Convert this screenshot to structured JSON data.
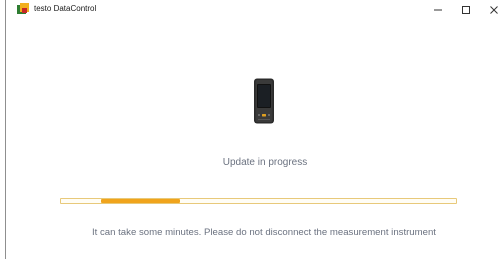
{
  "window": {
    "title": "testo DataControl",
    "icon": "testo-datacontrol-app-icon",
    "controls": {
      "minimize_icon": "minimize-icon",
      "maximize_icon": "maximize-icon",
      "close_icon": "close-icon"
    }
  },
  "main": {
    "device_icon": "handheld-device-icon",
    "status": "Update in progress",
    "progress": {
      "start_fraction": 0.1,
      "fill_fraction": 0.2,
      "indeterminate": true,
      "track_color": "#e8c97a",
      "fill_color": "#f0a41c"
    },
    "info": "It can take some minutes. Please do not disconnect the measurement instrument"
  }
}
